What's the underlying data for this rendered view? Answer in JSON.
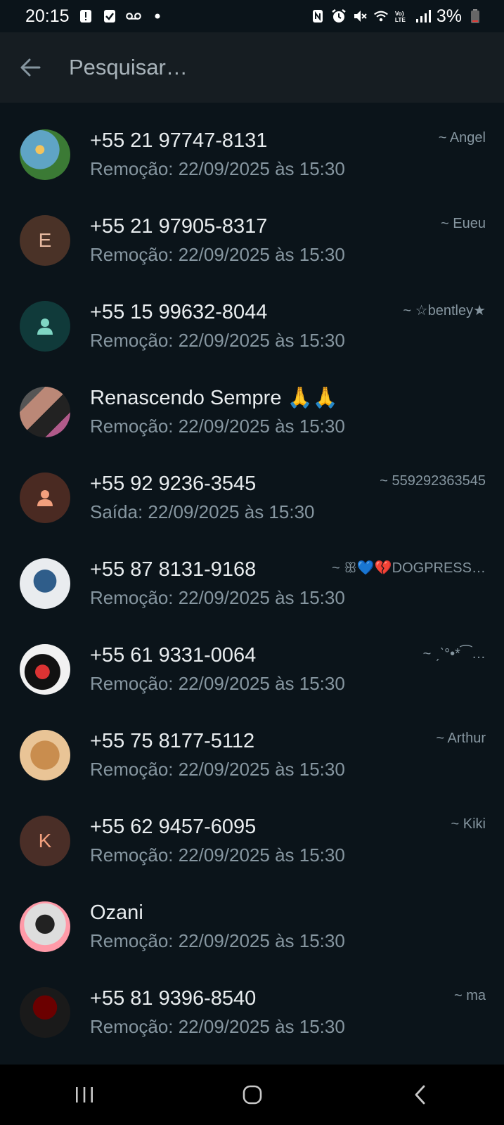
{
  "status_bar": {
    "time": "20:15",
    "battery": "3%",
    "icons": [
      "alert-icon",
      "check-icon",
      "voicemail-icon",
      "dot-icon",
      "nfc-icon",
      "alarm-icon",
      "mute-icon",
      "wifi-icon",
      "volte-icon",
      "signal-icon",
      "battery-icon"
    ]
  },
  "header": {
    "search_placeholder": "Pesquisar…"
  },
  "rows": [
    {
      "name": "+55 21 97747-8131",
      "sub": "Remoção: 22/09/2025 às 15:30",
      "tag": "~ Angel",
      "avatar": "image"
    },
    {
      "name": "+55 21 97905-8317",
      "sub": "Remoção: 22/09/2025 às 15:30",
      "tag": "~ Eueu",
      "avatar": "E"
    },
    {
      "name": "+55 15 99632-8044",
      "sub": "Remoção: 22/09/2025 às 15:30",
      "tag": "~ ☆bentley★",
      "avatar": "default-person"
    },
    {
      "name": "Renascendo Sempre 🙏🙏",
      "sub": "Remoção: 22/09/2025 às 15:30",
      "tag": "",
      "avatar": "image"
    },
    {
      "name": "+55 92 9236-3545",
      "sub": "Saída: 22/09/2025 às 15:30",
      "tag": "~ 559292363545",
      "avatar": "default-person"
    },
    {
      "name": "+55 87 8131-9168",
      "sub": "Remoção: 22/09/2025 às 15:30",
      "tag": "~ ꕥ💙💔DOGPRESS…",
      "avatar": "image"
    },
    {
      "name": "+55 61 9331-0064",
      "sub": "Remoção: 22/09/2025 às 15:30",
      "tag": "~ ˏˋ°•*⁀…",
      "avatar": "image"
    },
    {
      "name": "+55 75 8177-5112",
      "sub": "Remoção: 22/09/2025 às 15:30",
      "tag": "~ Arthur",
      "avatar": "image"
    },
    {
      "name": "+55 62 9457-6095",
      "sub": "Remoção: 22/09/2025 às 15:30",
      "tag": "~ Kiki",
      "avatar": "K"
    },
    {
      "name": "Ozani",
      "sub": "Remoção: 22/09/2025 às 15:30",
      "tag": "",
      "avatar": "image"
    },
    {
      "name": "+55 81 9396-8540",
      "sub": "Remoção: 22/09/2025 às 15:30",
      "tag": "~ ma",
      "avatar": "image"
    }
  ],
  "colors": {
    "background": "#0b141a",
    "header": "#161d22",
    "primary_text": "#e9edef",
    "secondary_text": "#8696a0",
    "teal_avatar": "#103a3a",
    "peach_avatar": "#4a2a22"
  },
  "nav": [
    "recent-apps-icon",
    "home-icon",
    "back-icon"
  ]
}
